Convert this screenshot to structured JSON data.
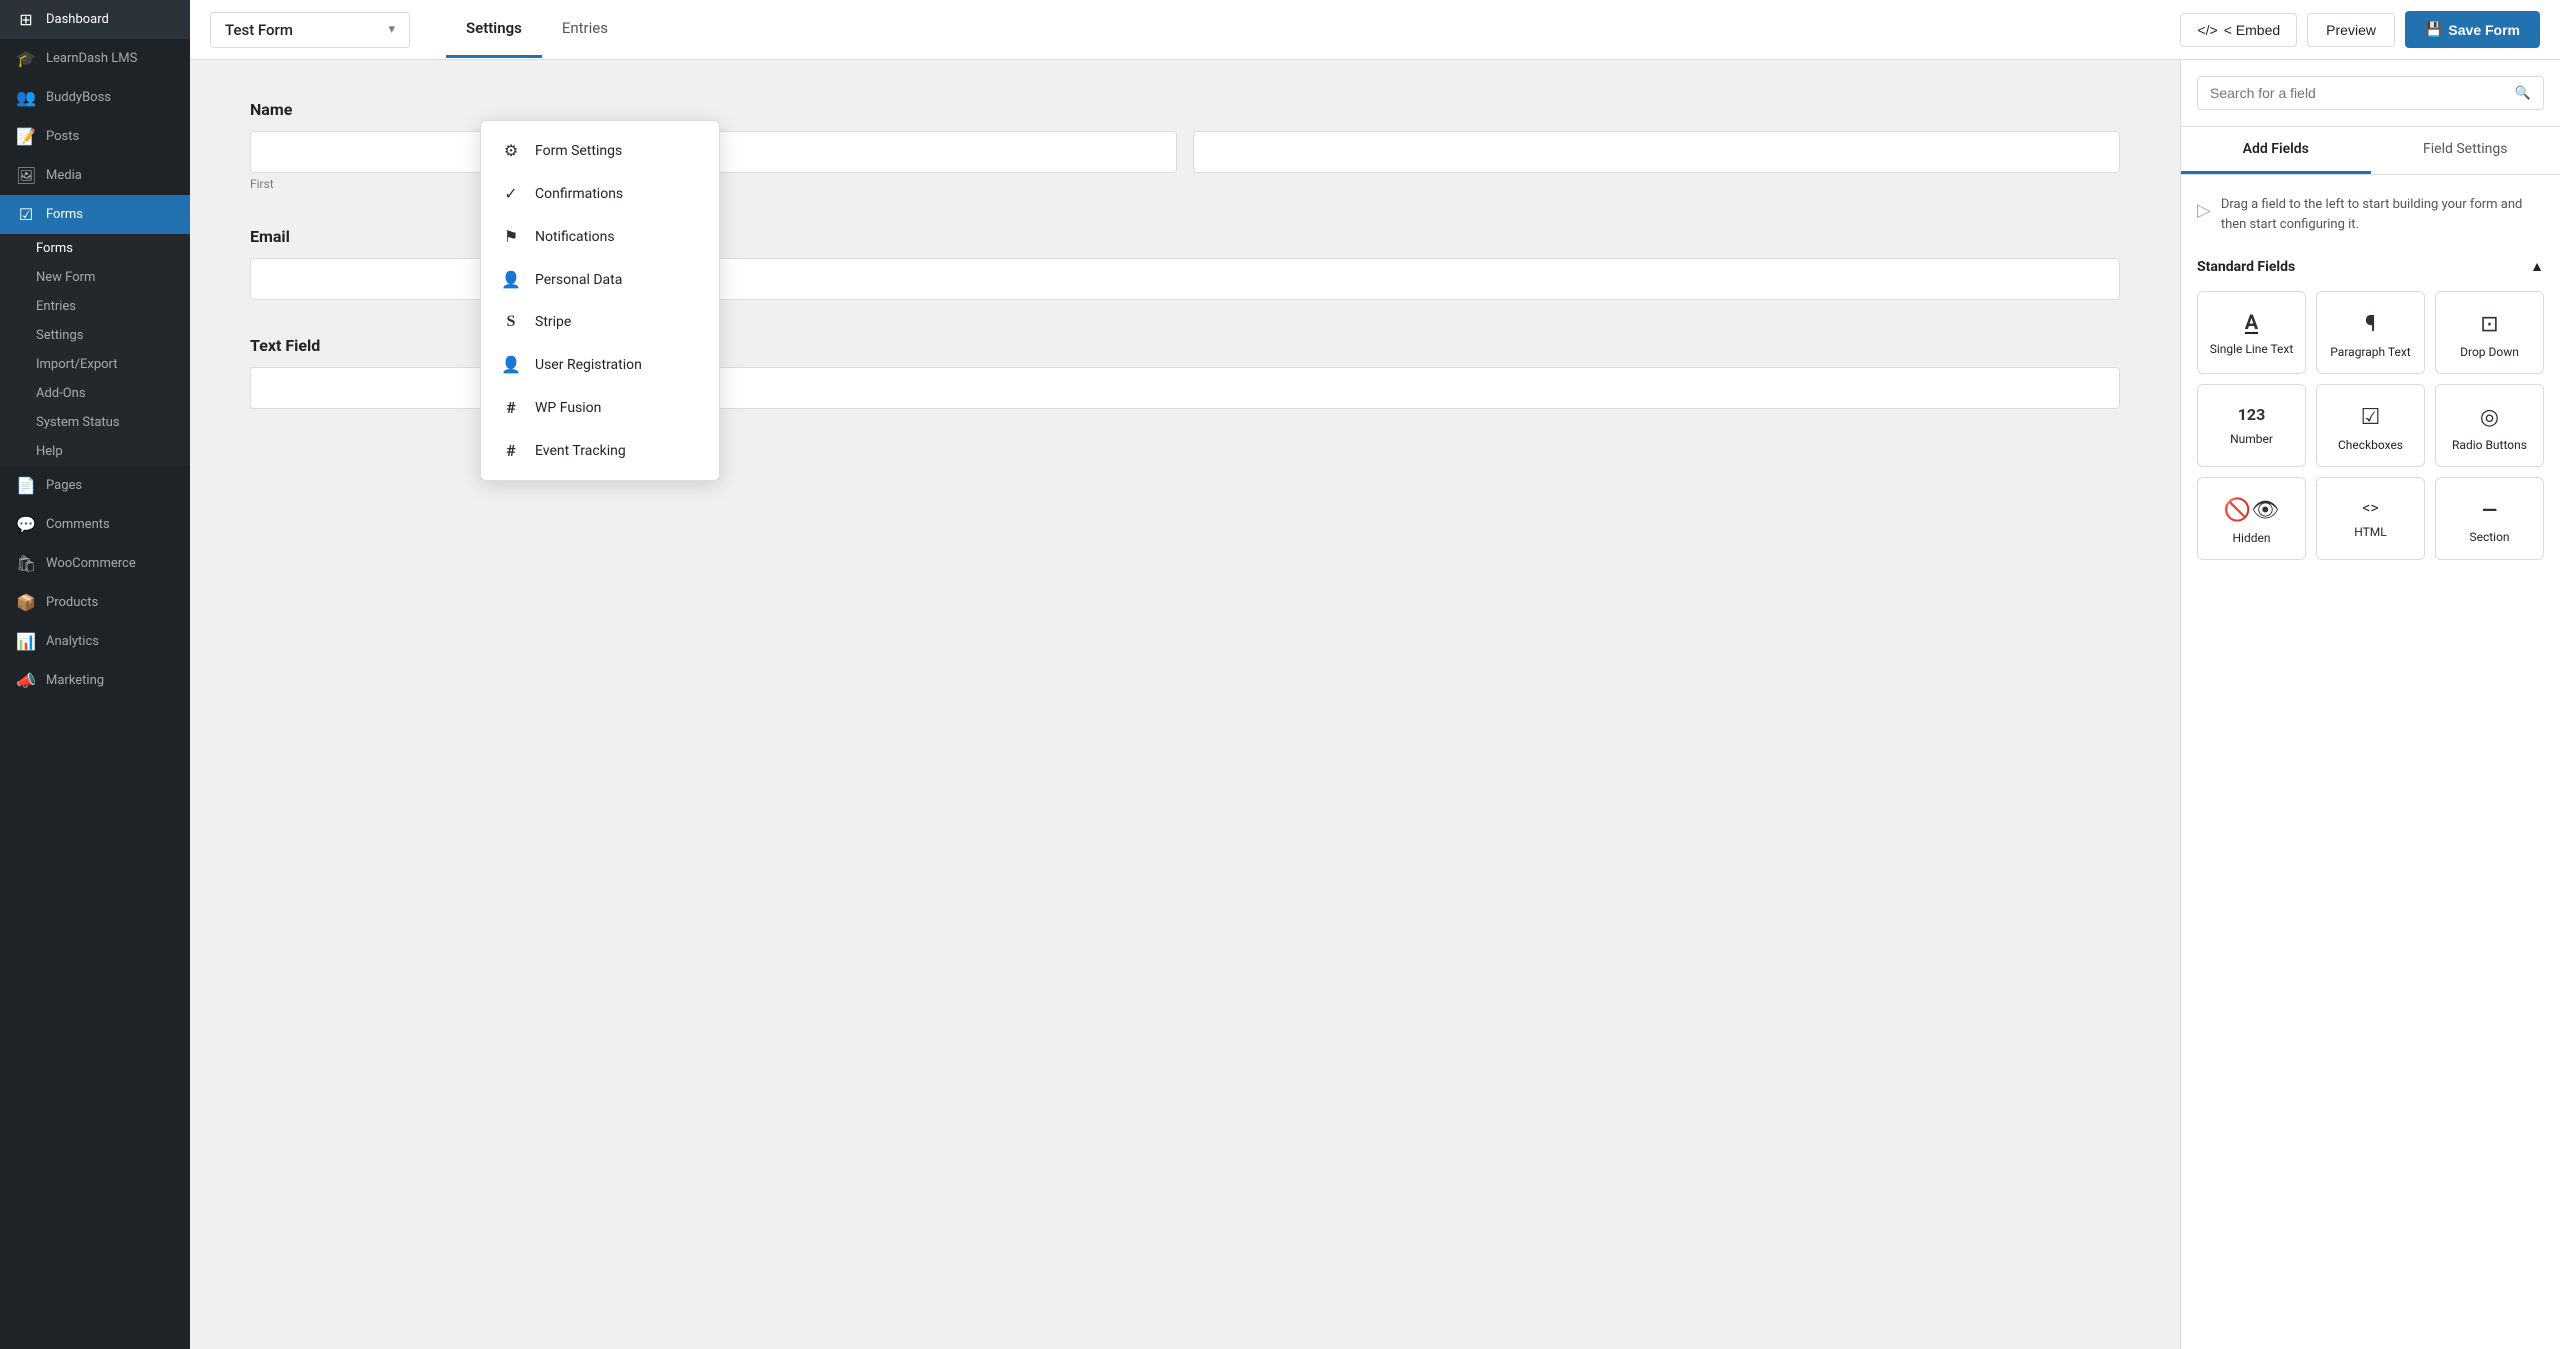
{
  "sidebar": {
    "items": [
      {
        "id": "dashboard",
        "label": "Dashboard",
        "icon": "⊞"
      },
      {
        "id": "learndash",
        "label": "LearnDash LMS",
        "icon": "🎓"
      },
      {
        "id": "buddyboss",
        "label": "BuddyBoss",
        "icon": "👥"
      },
      {
        "id": "posts",
        "label": "Posts",
        "icon": "📝"
      },
      {
        "id": "media",
        "label": "Media",
        "icon": "🖼"
      },
      {
        "id": "forms",
        "label": "Forms",
        "icon": "☑"
      },
      {
        "id": "pages",
        "label": "Pages",
        "icon": "📄"
      },
      {
        "id": "comments",
        "label": "Comments",
        "icon": "💬"
      },
      {
        "id": "woocommerce",
        "label": "WooCommerce",
        "icon": "🛍"
      },
      {
        "id": "products",
        "label": "Products",
        "icon": "📦"
      },
      {
        "id": "analytics",
        "label": "Analytics",
        "icon": "📊"
      },
      {
        "id": "marketing",
        "label": "Marketing",
        "icon": "📣"
      }
    ],
    "forms_sub": [
      {
        "id": "forms-list",
        "label": "Forms"
      },
      {
        "id": "new-form",
        "label": "New Form"
      },
      {
        "id": "entries",
        "label": "Entries"
      },
      {
        "id": "settings",
        "label": "Settings"
      },
      {
        "id": "import-export",
        "label": "Import/Export"
      },
      {
        "id": "add-ons",
        "label": "Add-Ons"
      },
      {
        "id": "system-status",
        "label": "System Status"
      },
      {
        "id": "help",
        "label": "Help"
      }
    ]
  },
  "topbar": {
    "form_name": "Test Form",
    "tabs": [
      {
        "id": "settings",
        "label": "Settings",
        "active": true
      },
      {
        "id": "entries",
        "label": "Entries",
        "active": false
      }
    ],
    "embed_label": "< Embed",
    "preview_label": "Preview",
    "save_label": "Save Form",
    "save_icon": "💾"
  },
  "dropdown": {
    "items": [
      {
        "id": "form-settings",
        "label": "Form Settings",
        "icon": "⚙"
      },
      {
        "id": "confirmations",
        "label": "Confirmations",
        "icon": "✓"
      },
      {
        "id": "notifications",
        "label": "Notifications",
        "icon": "⚑"
      },
      {
        "id": "personal-data",
        "label": "Personal Data",
        "icon": "👤"
      },
      {
        "id": "stripe",
        "label": "Stripe",
        "icon": "S"
      },
      {
        "id": "user-registration",
        "label": "User Registration",
        "icon": "👤"
      },
      {
        "id": "wp-fusion",
        "label": "WP Fusion",
        "icon": "#"
      },
      {
        "id": "event-tracking",
        "label": "Event Tracking",
        "icon": "#"
      }
    ]
  },
  "form": {
    "fields": [
      {
        "id": "name",
        "label": "Name",
        "inputs": [
          {
            "placeholder": "",
            "subtext": "First"
          },
          {
            "placeholder": "",
            "subtext": ""
          }
        ],
        "type": "name"
      },
      {
        "id": "email",
        "label": "Email",
        "inputs": [
          {
            "placeholder": "",
            "subtext": ""
          }
        ],
        "type": "single"
      },
      {
        "id": "text-field",
        "label": "Text Field",
        "inputs": [
          {
            "placeholder": "",
            "subtext": ""
          }
        ],
        "type": "single"
      }
    ]
  },
  "right_panel": {
    "search_placeholder": "Search for a field",
    "tabs": [
      {
        "id": "add-fields",
        "label": "Add Fields",
        "active": true
      },
      {
        "id": "field-settings",
        "label": "Field Settings",
        "active": false
      }
    ],
    "drag_hint": "Drag a field to the left to start building your form and then start configuring it.",
    "standard_fields_label": "Standard Fields",
    "fields": [
      {
        "id": "single-line-text",
        "label": "Single Line Text",
        "icon": "A̲"
      },
      {
        "id": "paragraph-text",
        "label": "Paragraph Text",
        "icon": "¶"
      },
      {
        "id": "drop-down",
        "label": "Drop Down",
        "icon": "⊡"
      },
      {
        "id": "number",
        "label": "Number",
        "icon": "123"
      },
      {
        "id": "checkboxes",
        "label": "Checkboxes",
        "icon": "☑"
      },
      {
        "id": "radio-buttons",
        "label": "Radio Buttons",
        "icon": "◎"
      },
      {
        "id": "hidden",
        "label": "Hidden",
        "icon": "👁"
      },
      {
        "id": "html",
        "label": "HTML",
        "icon": "<>"
      },
      {
        "id": "section",
        "label": "Section",
        "icon": "—"
      }
    ]
  }
}
